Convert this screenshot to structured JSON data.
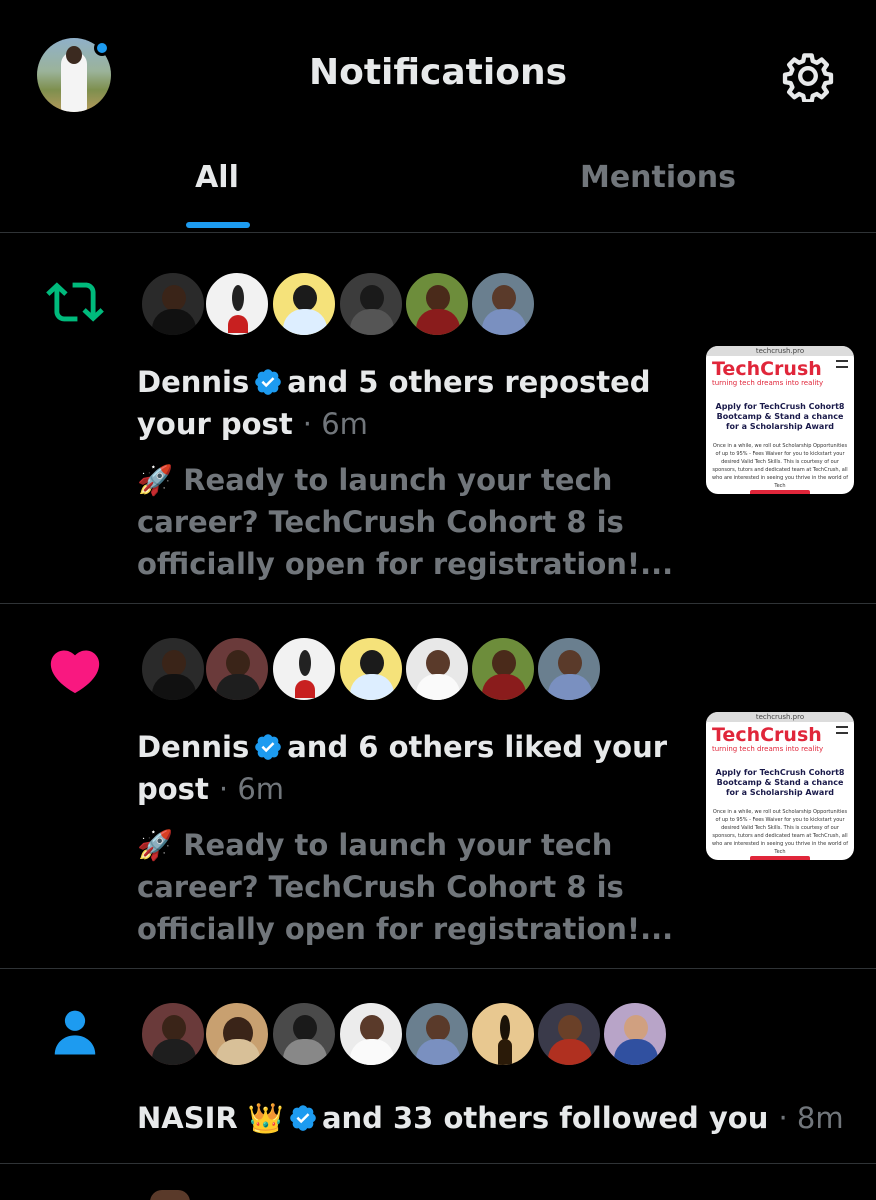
{
  "header": {
    "title": "Notifications",
    "avatar_icon": "profile-avatar",
    "settings_icon": "gear-icon"
  },
  "tabs": [
    {
      "label": "All",
      "active": true
    },
    {
      "label": "Mentions",
      "active": false
    }
  ],
  "notifications": [
    {
      "type": "repost",
      "icon": "repost-icon",
      "icon_color": "#00ba7c",
      "actor": "Dennis",
      "action": "and 5 others reposted your post",
      "action_line1": "and 5 others reposted",
      "action_line2": "your post",
      "time": "· 6m",
      "preview_emoji": "🚀",
      "preview_line1": "Ready to launch your tech",
      "preview_line2": "career? TechCrush Cohort 8 is",
      "preview_line3": "officially open for registration!...",
      "thumbnail": {
        "url": "techcrush.pro",
        "logo": "TechCrush",
        "tagline": "turning tech dreams into reality",
        "heading": "Apply for TechCrush Cohort8 Bootcamp & Stand a chance for a Scholarship Award",
        "body": "Once in a while, we roll out Scholarship Opportunities of up to 95% - Fees Waiver for you to kickstart your desired Valid Tech Skills. This is courtesy of our sponsors, tutors and dedicated team at TechCrush, all who are interested in seeing you thrive in the world of Tech"
      }
    },
    {
      "type": "like",
      "icon": "heart-icon",
      "icon_color": "#f91880",
      "actor": "Dennis",
      "action_line1": "and 6 others liked your",
      "action_line2": "post",
      "time": "· 6m",
      "preview_emoji": "🚀",
      "preview_line1": "Ready to launch your tech",
      "preview_line2": "career? TechCrush Cohort 8 is",
      "preview_line3": "officially open for registration!...",
      "thumbnail": {
        "url": "techcrush.pro",
        "logo": "TechCrush",
        "tagline": "turning tech dreams into reality",
        "heading": "Apply for TechCrush Cohort8 Bootcamp & Stand a chance for a Scholarship Award",
        "body": "Once in a while, we roll out Scholarship Opportunities of up to 95% - Fees Waiver for you to kickstart your desired Valid Tech Skills. This is courtesy of our sponsors, tutors and dedicated team at TechCrush, all who are interested in seeing you thrive in the world of Tech"
      }
    },
    {
      "type": "follow",
      "icon": "person-icon",
      "icon_color": "#1d9bf0",
      "actor": "NASIR 👑",
      "action_line1": "and 33 others followed you",
      "time": "· 8m"
    }
  ],
  "colors": {
    "accent": "#1d9bf0",
    "background": "#000000",
    "text": "#e7e9ea",
    "muted": "#71767b",
    "divider": "#2f3336"
  }
}
